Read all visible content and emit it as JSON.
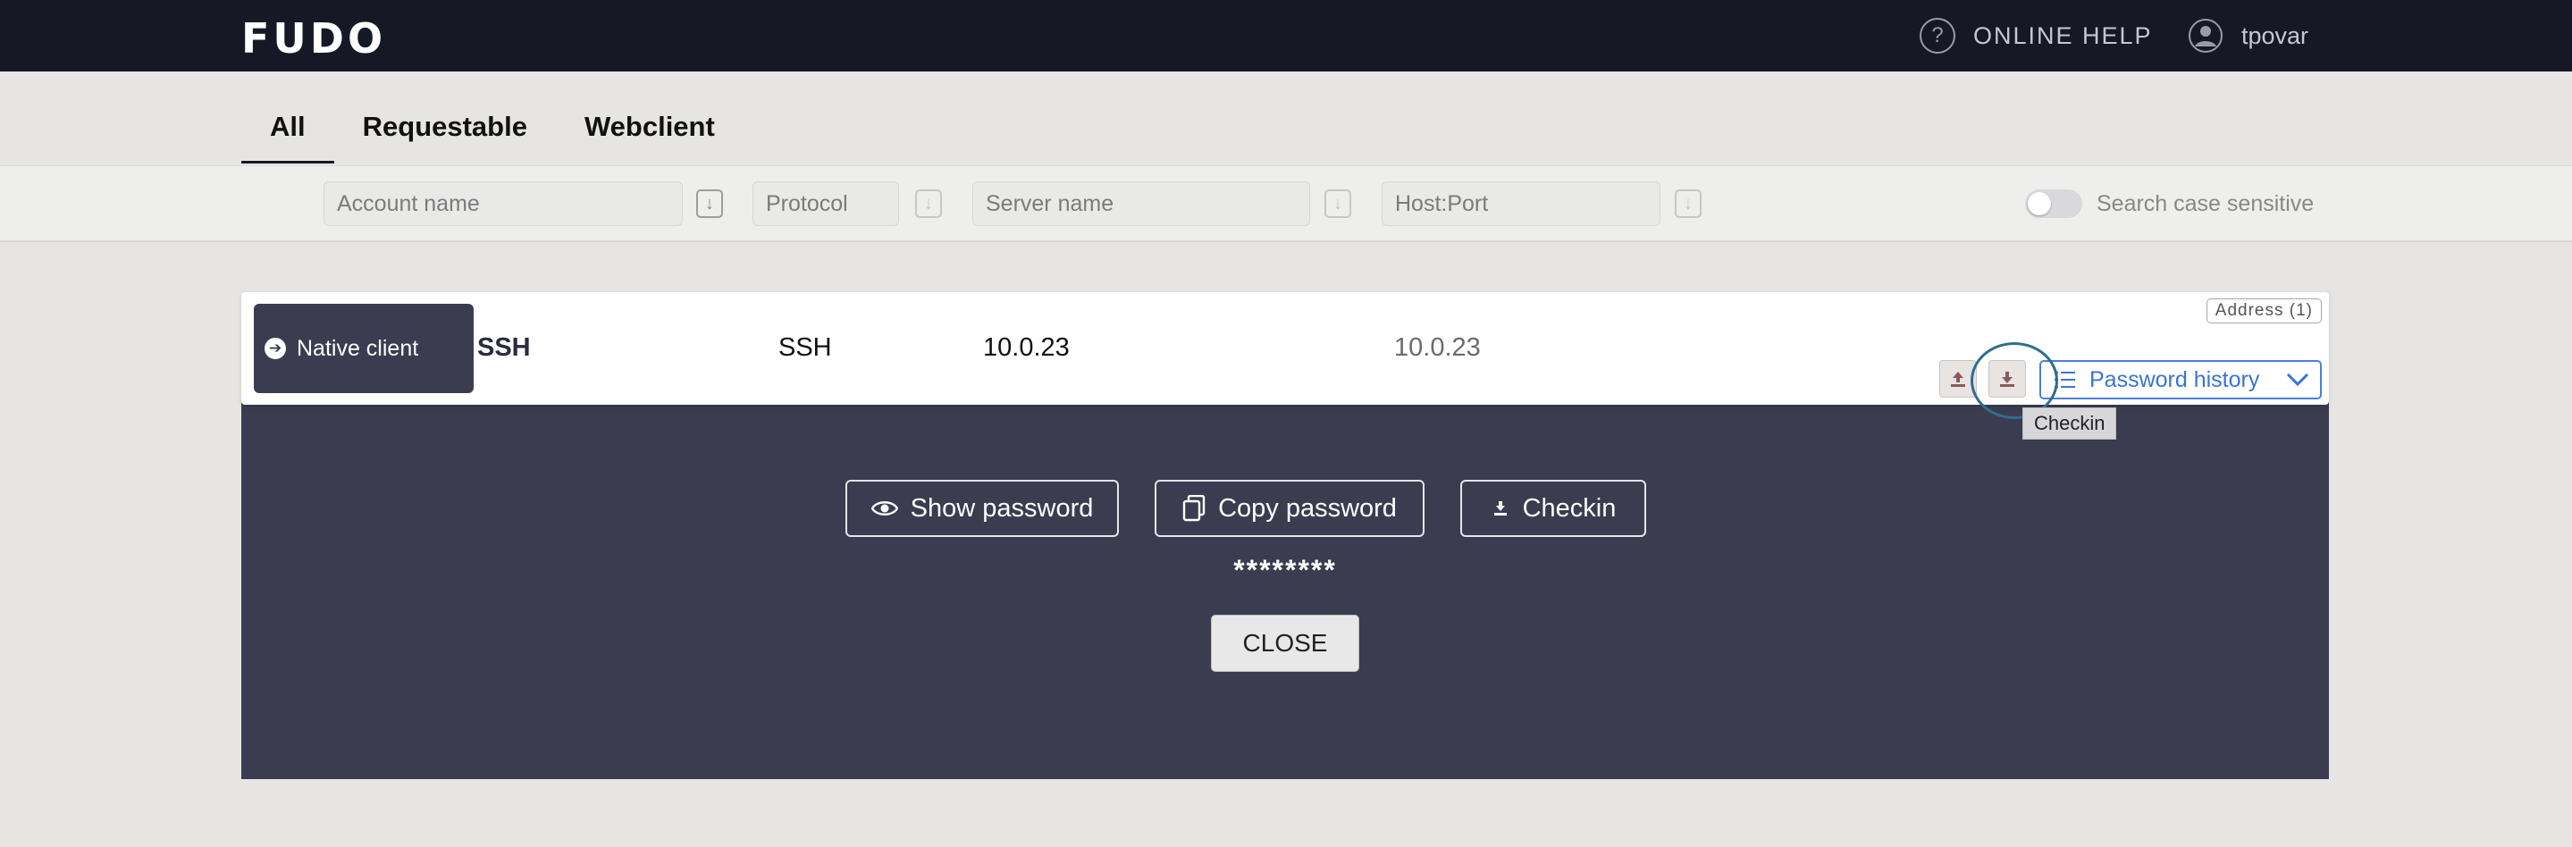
{
  "header": {
    "logo": "FUDO",
    "help_icon_glyph": "?",
    "help_label": "ONLINE HELP",
    "username": "tpovar"
  },
  "tabs": [
    {
      "label": "All",
      "active": true
    },
    {
      "label": "Requestable",
      "active": false
    },
    {
      "label": "Webclient",
      "active": false
    }
  ],
  "filters": {
    "account_placeholder": "Account name",
    "protocol_placeholder": "Protocol",
    "server_placeholder": "Server name",
    "hostport_placeholder": "Host:Port",
    "case_sensitive_label": "Search case sensitive"
  },
  "row": {
    "native_client_label": "Native client",
    "account": "SSH",
    "protocol": "SSH",
    "server": "10.0.23",
    "host": "10.0.23",
    "address_badge": "Address (1)",
    "password_history_label": "Password history",
    "tooltip": "Checkin"
  },
  "panel": {
    "show_password_label": "Show password",
    "copy_password_label": "Copy password",
    "checkin_label": "Checkin",
    "masked_password": "********",
    "close_label": "CLOSE"
  },
  "colors": {
    "topbar": "#171826",
    "panel": "#3c3c50",
    "accent_blue": "#3a74d4",
    "highlight_ring": "#2e6e8e"
  }
}
